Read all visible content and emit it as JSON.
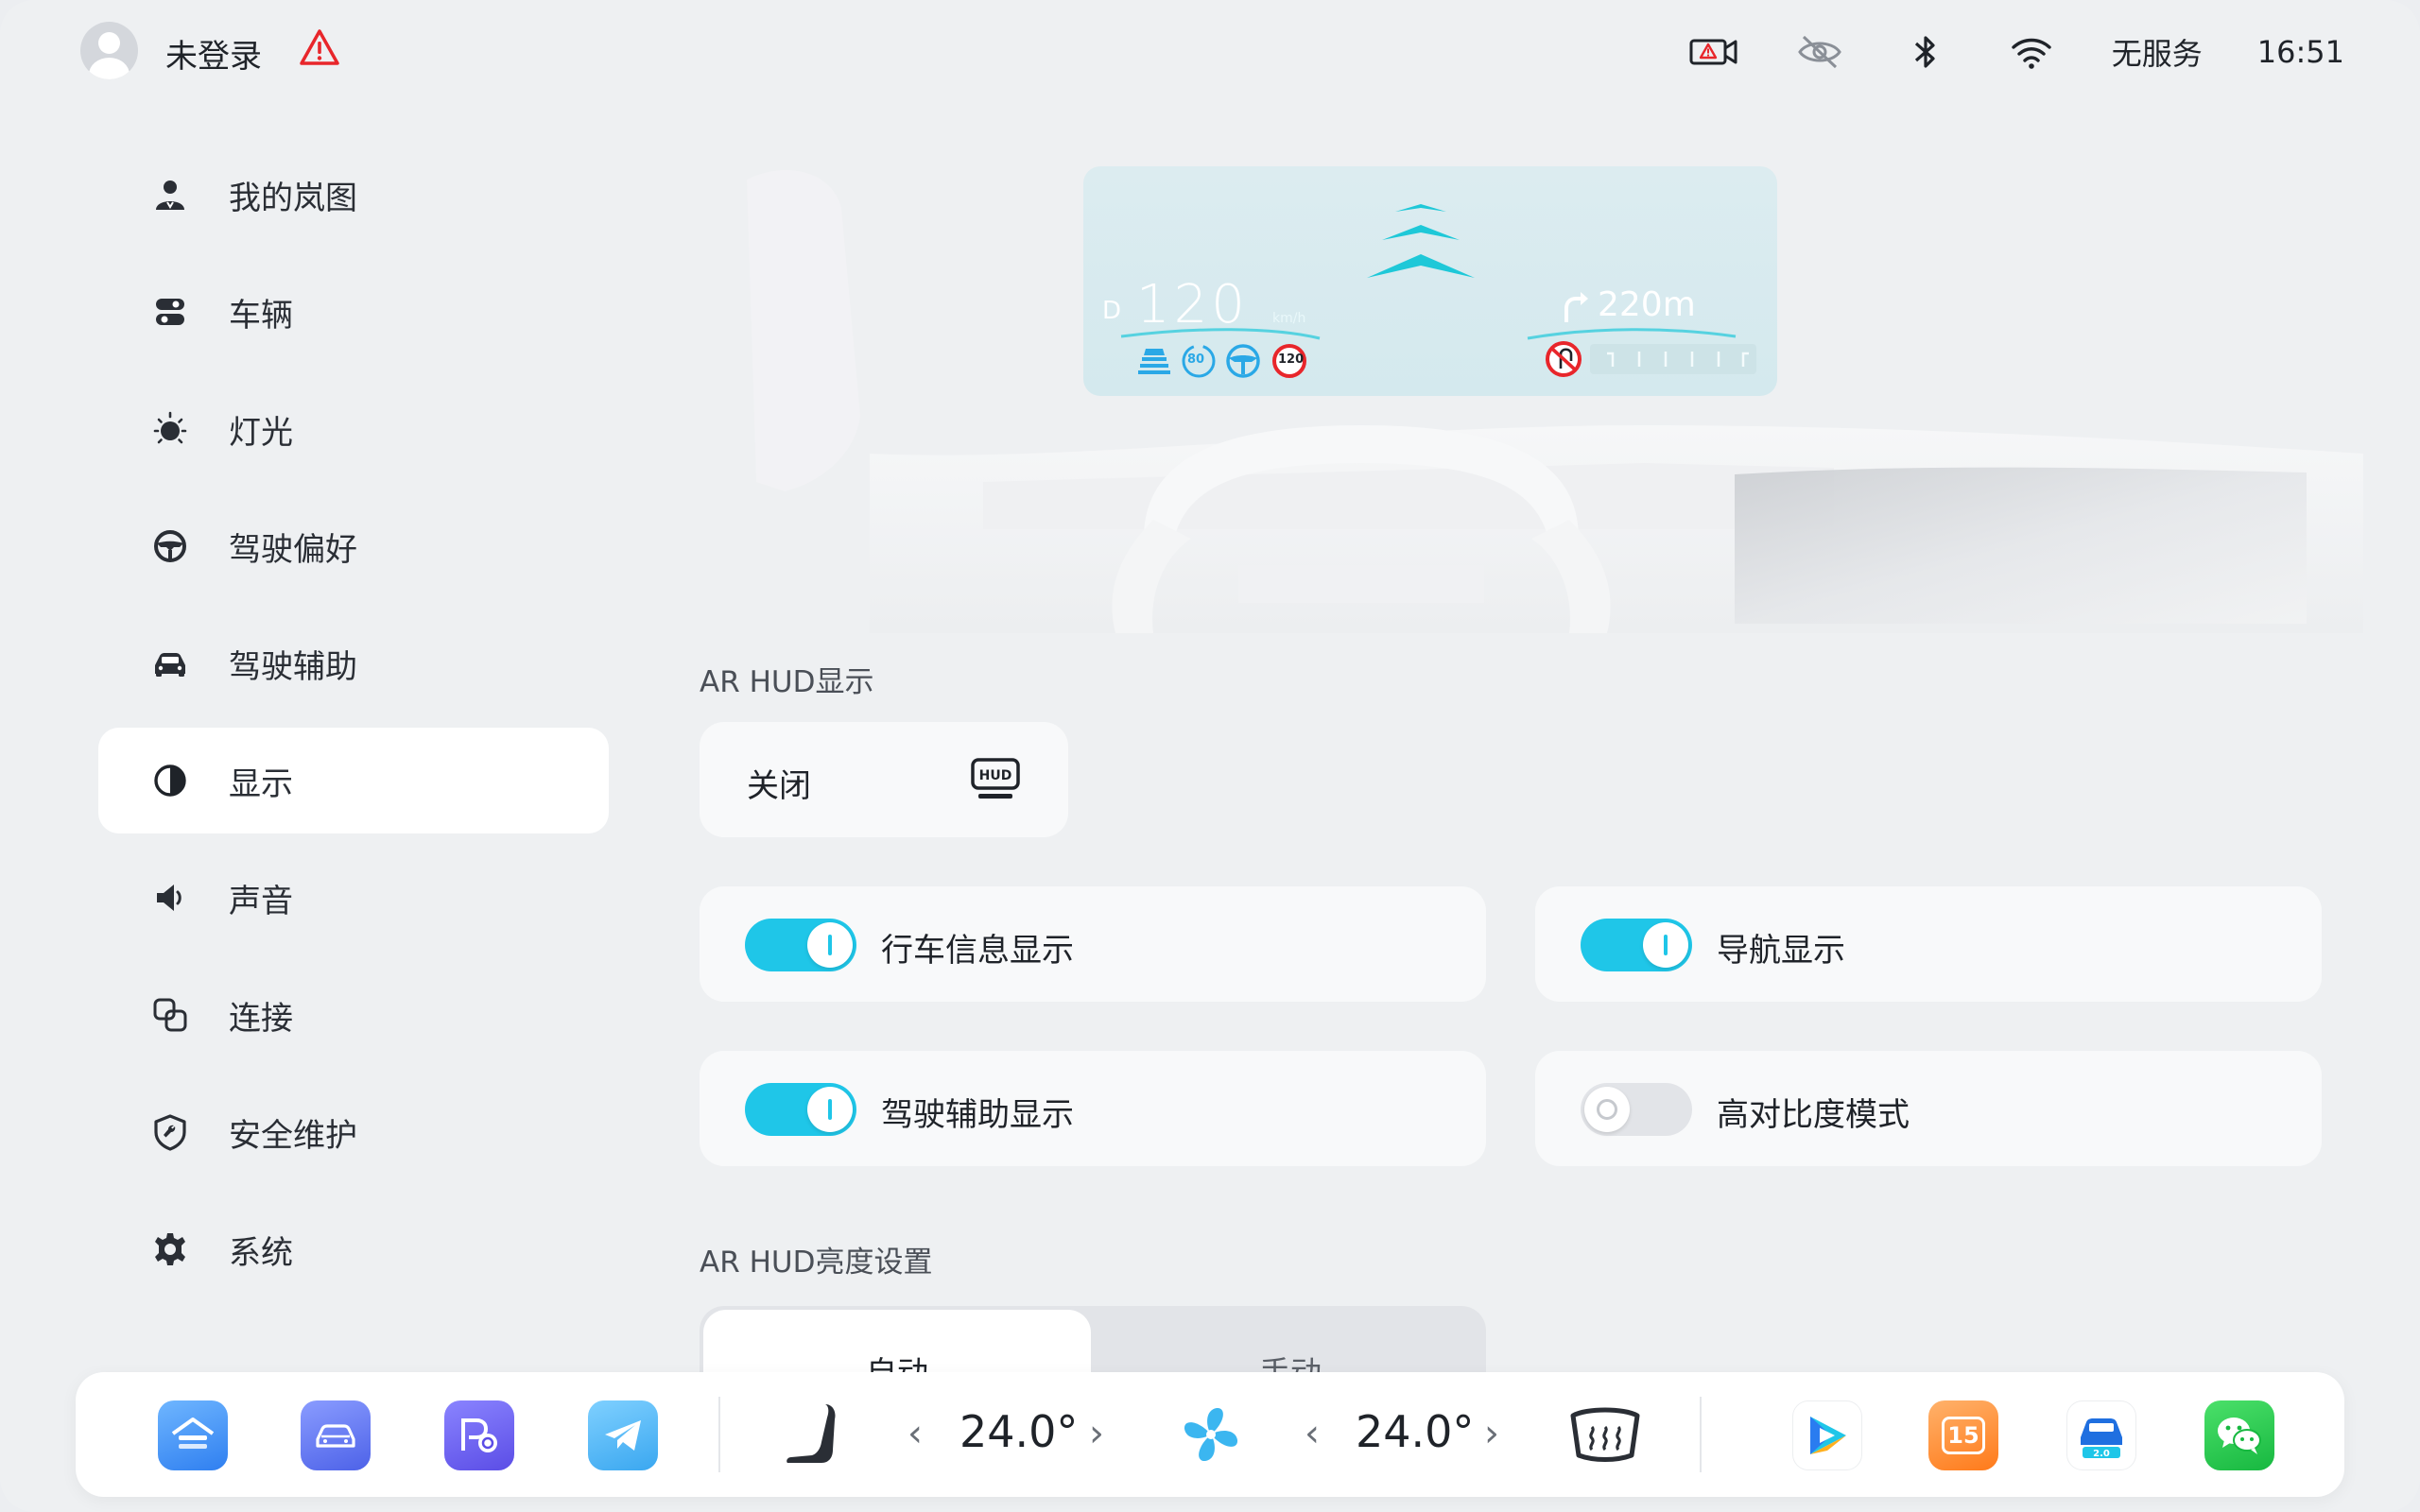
{
  "status_bar": {
    "user_name": "未登录",
    "network": "无服务",
    "time": "16:51"
  },
  "sidebar": {
    "items": [
      {
        "label": "我的岚图",
        "icon": "user-icon"
      },
      {
        "label": "车辆",
        "icon": "vehicle-settings-icon"
      },
      {
        "label": "灯光",
        "icon": "light-icon"
      },
      {
        "label": "驾驶偏好",
        "icon": "steering-wheel-icon"
      },
      {
        "label": "驾驶辅助",
        "icon": "car-assist-icon"
      },
      {
        "label": "显示",
        "icon": "display-contrast-icon",
        "active": true
      },
      {
        "label": "声音",
        "icon": "speaker-icon"
      },
      {
        "label": "连接",
        "icon": "connection-icon"
      },
      {
        "label": "安全维护",
        "icon": "shield-wrench-icon"
      },
      {
        "label": "系统",
        "icon": "gear-icon"
      }
    ]
  },
  "hud_preview": {
    "gear": "D",
    "speed": "120",
    "speed_unit": "km/h",
    "acc_speed": "80",
    "speed_limit": "120",
    "nav_distance": "220m"
  },
  "ar_hud": {
    "section_title": "AR HUD显示",
    "mode_label": "关闭",
    "mode_icon": "HUD",
    "toggles": [
      {
        "label": "行车信息显示",
        "on": true
      },
      {
        "label": "导航显示",
        "on": true
      },
      {
        "label": "驾驶辅助显示",
        "on": true
      },
      {
        "label": "高对比度模式",
        "on": false
      }
    ]
  },
  "brightness": {
    "section_title": "AR HUD亮度设置",
    "options": [
      "自动",
      "手动"
    ],
    "selected": "自动"
  },
  "dock": {
    "left_temp": "24.0°",
    "right_temp": "24.0°",
    "chevron_left": "‹",
    "chevron_right": "›",
    "calendar_day": "15",
    "car_version": "2.0"
  },
  "colors": {
    "accent": "#1fc6e8",
    "background": "#eef0f2",
    "card": "#f8f9fa"
  }
}
